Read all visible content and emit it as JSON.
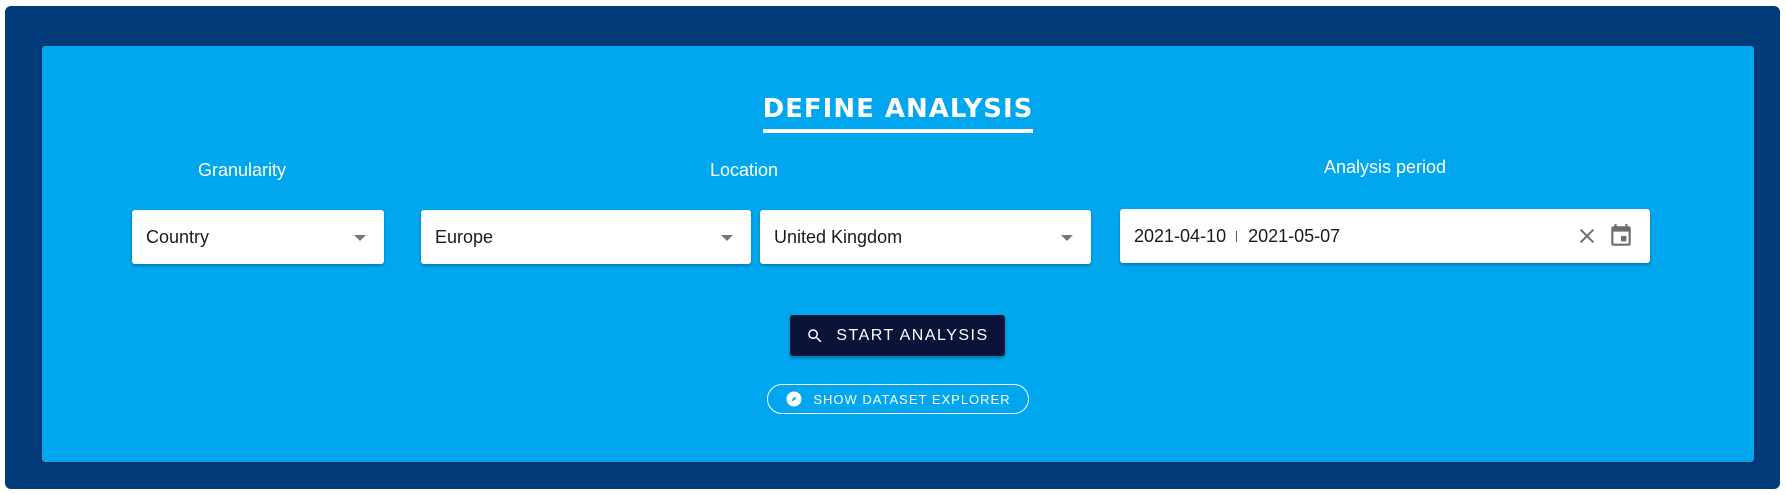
{
  "title": "DEFINE ANALYSIS",
  "granularity": {
    "label": "Granularity",
    "value": "Country"
  },
  "location": {
    "label": "Location",
    "region": "Europe",
    "country": "United Kingdom"
  },
  "period": {
    "label": "Analysis period",
    "start": "2021-04-10",
    "end": "2021-05-07"
  },
  "actions": {
    "start_label": "START ANALYSIS",
    "explorer_label": "SHOW DATASET EXPLORER"
  },
  "icons": {
    "start": "search-icon",
    "explorer": "compass-icon",
    "clear": "close-icon",
    "calendar": "calendar-icon",
    "dropdown": "caret-down-icon"
  },
  "colors": {
    "frame": "#033a7a",
    "panel": "#00a7ee",
    "primary_button": "#0b1339"
  }
}
